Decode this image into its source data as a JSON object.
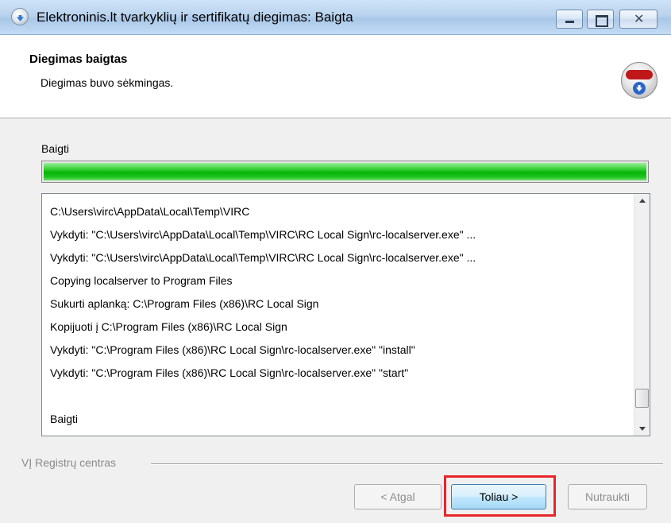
{
  "window": {
    "title": "Elektroninis.lt tvarkyklių ir sertifikatų diegimas: Baigta",
    "buttons": {
      "minimize": "minimize",
      "maximize": "maximize",
      "close": "✕"
    }
  },
  "header": {
    "title": "Diegimas baigtas",
    "subtitle": "Diegimas buvo sėkmingas.",
    "icon": "installer-icon"
  },
  "progress": {
    "label": "Baigti",
    "value_percent": 100,
    "color": "#1ec41e"
  },
  "log": {
    "lines": [
      "C:\\Users\\virc\\AppData\\Local\\Temp\\VIRC",
      "Vykdyti: \"C:\\Users\\virc\\AppData\\Local\\Temp\\VIRC\\RC Local Sign\\rc-localserver.exe\" ...",
      "Vykdyti: \"C:\\Users\\virc\\AppData\\Local\\Temp\\VIRC\\RC Local Sign\\rc-localserver.exe\" ...",
      "Copying localserver to Program Files",
      "Sukurti aplanką: C:\\Program Files (x86)\\RC Local Sign",
      "Kopijuoti į C:\\Program Files (x86)\\RC Local Sign",
      "Vykdyti: \"C:\\Program Files (x86)\\RC Local Sign\\rc-localserver.exe\" \"install\"",
      "Vykdyti: \"C:\\Program Files (x86)\\RC Local Sign\\rc-localserver.exe\" \"start\"",
      "",
      "Baigti"
    ]
  },
  "footer": {
    "branding": "VĮ Registrų centras",
    "back_label": "< Atgal",
    "next_label": "Toliau >",
    "cancel_label": "Nutraukti",
    "highlight_color": "#e8262a"
  }
}
